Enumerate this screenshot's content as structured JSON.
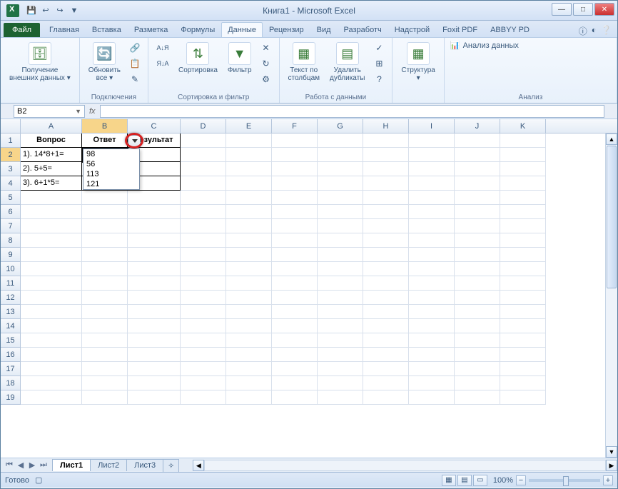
{
  "titlebar": {
    "title": "Книга1 - Microsoft Excel",
    "qat": [
      "💾",
      "↩",
      "↪",
      "▼"
    ]
  },
  "ribbon": {
    "file": "Файл",
    "tabs": [
      "Главная",
      "Вставка",
      "Разметка",
      "Формулы",
      "Данные",
      "Рецензир",
      "Вид",
      "Разработч",
      "Надстрой",
      "Foxit PDF",
      "ABBYY PD"
    ],
    "active_tab": "Данные",
    "help_icons": [
      "ⓘ",
      "ⓘ",
      "ⓘ",
      "◑",
      "❔"
    ],
    "groups": {
      "ext_data": {
        "btn": "Получение\nвнешних данных ▾",
        "label": ""
      },
      "connections": {
        "btn": "Обновить\nвсе ▾",
        "label": "Подключения"
      },
      "sort_filter": {
        "sort_az": "А↓Я",
        "sort_za": "Я↓А",
        "sort_btn": "Сортировка",
        "filter_btn": "Фильтр",
        "label": "Сортировка и фильтр"
      },
      "data_tools": {
        "text_cols": "Текст по\nстолбцам",
        "dedupe": "Удалить\nдубликаты",
        "label": "Работа с данными"
      },
      "outline": {
        "btn": "Структура\n▾",
        "label": ""
      },
      "analysis": {
        "btn": "Анализ данных",
        "label": "Анализ"
      }
    }
  },
  "formula_bar": {
    "name_box": "B2",
    "fx": "fx",
    "formula_value": ""
  },
  "grid": {
    "columns": [
      "A",
      "B",
      "C",
      "D",
      "E",
      "F",
      "G",
      "H",
      "I",
      "J",
      "K"
    ],
    "active_col": "B",
    "active_row": 2,
    "rows_visible": 19,
    "headers": {
      "A": "Вопрос",
      "B": "Ответ",
      "C": "Результат"
    },
    "data": {
      "A2": "1). 14*8+1=",
      "A3": "2). 5+5=",
      "A4": "3). 6+1*5="
    },
    "dropdown": {
      "options": [
        "98",
        "56",
        "113",
        "121"
      ]
    }
  },
  "sheets": {
    "nav": [
      "⏮",
      "◀",
      "▶",
      "⏭"
    ],
    "tabs": [
      "Лист1",
      "Лист2",
      "Лист3"
    ],
    "active": "Лист1",
    "new_icon": "✧"
  },
  "statusbar": {
    "ready": "Готово",
    "zoom": "100%",
    "minus": "−",
    "plus": "+"
  }
}
